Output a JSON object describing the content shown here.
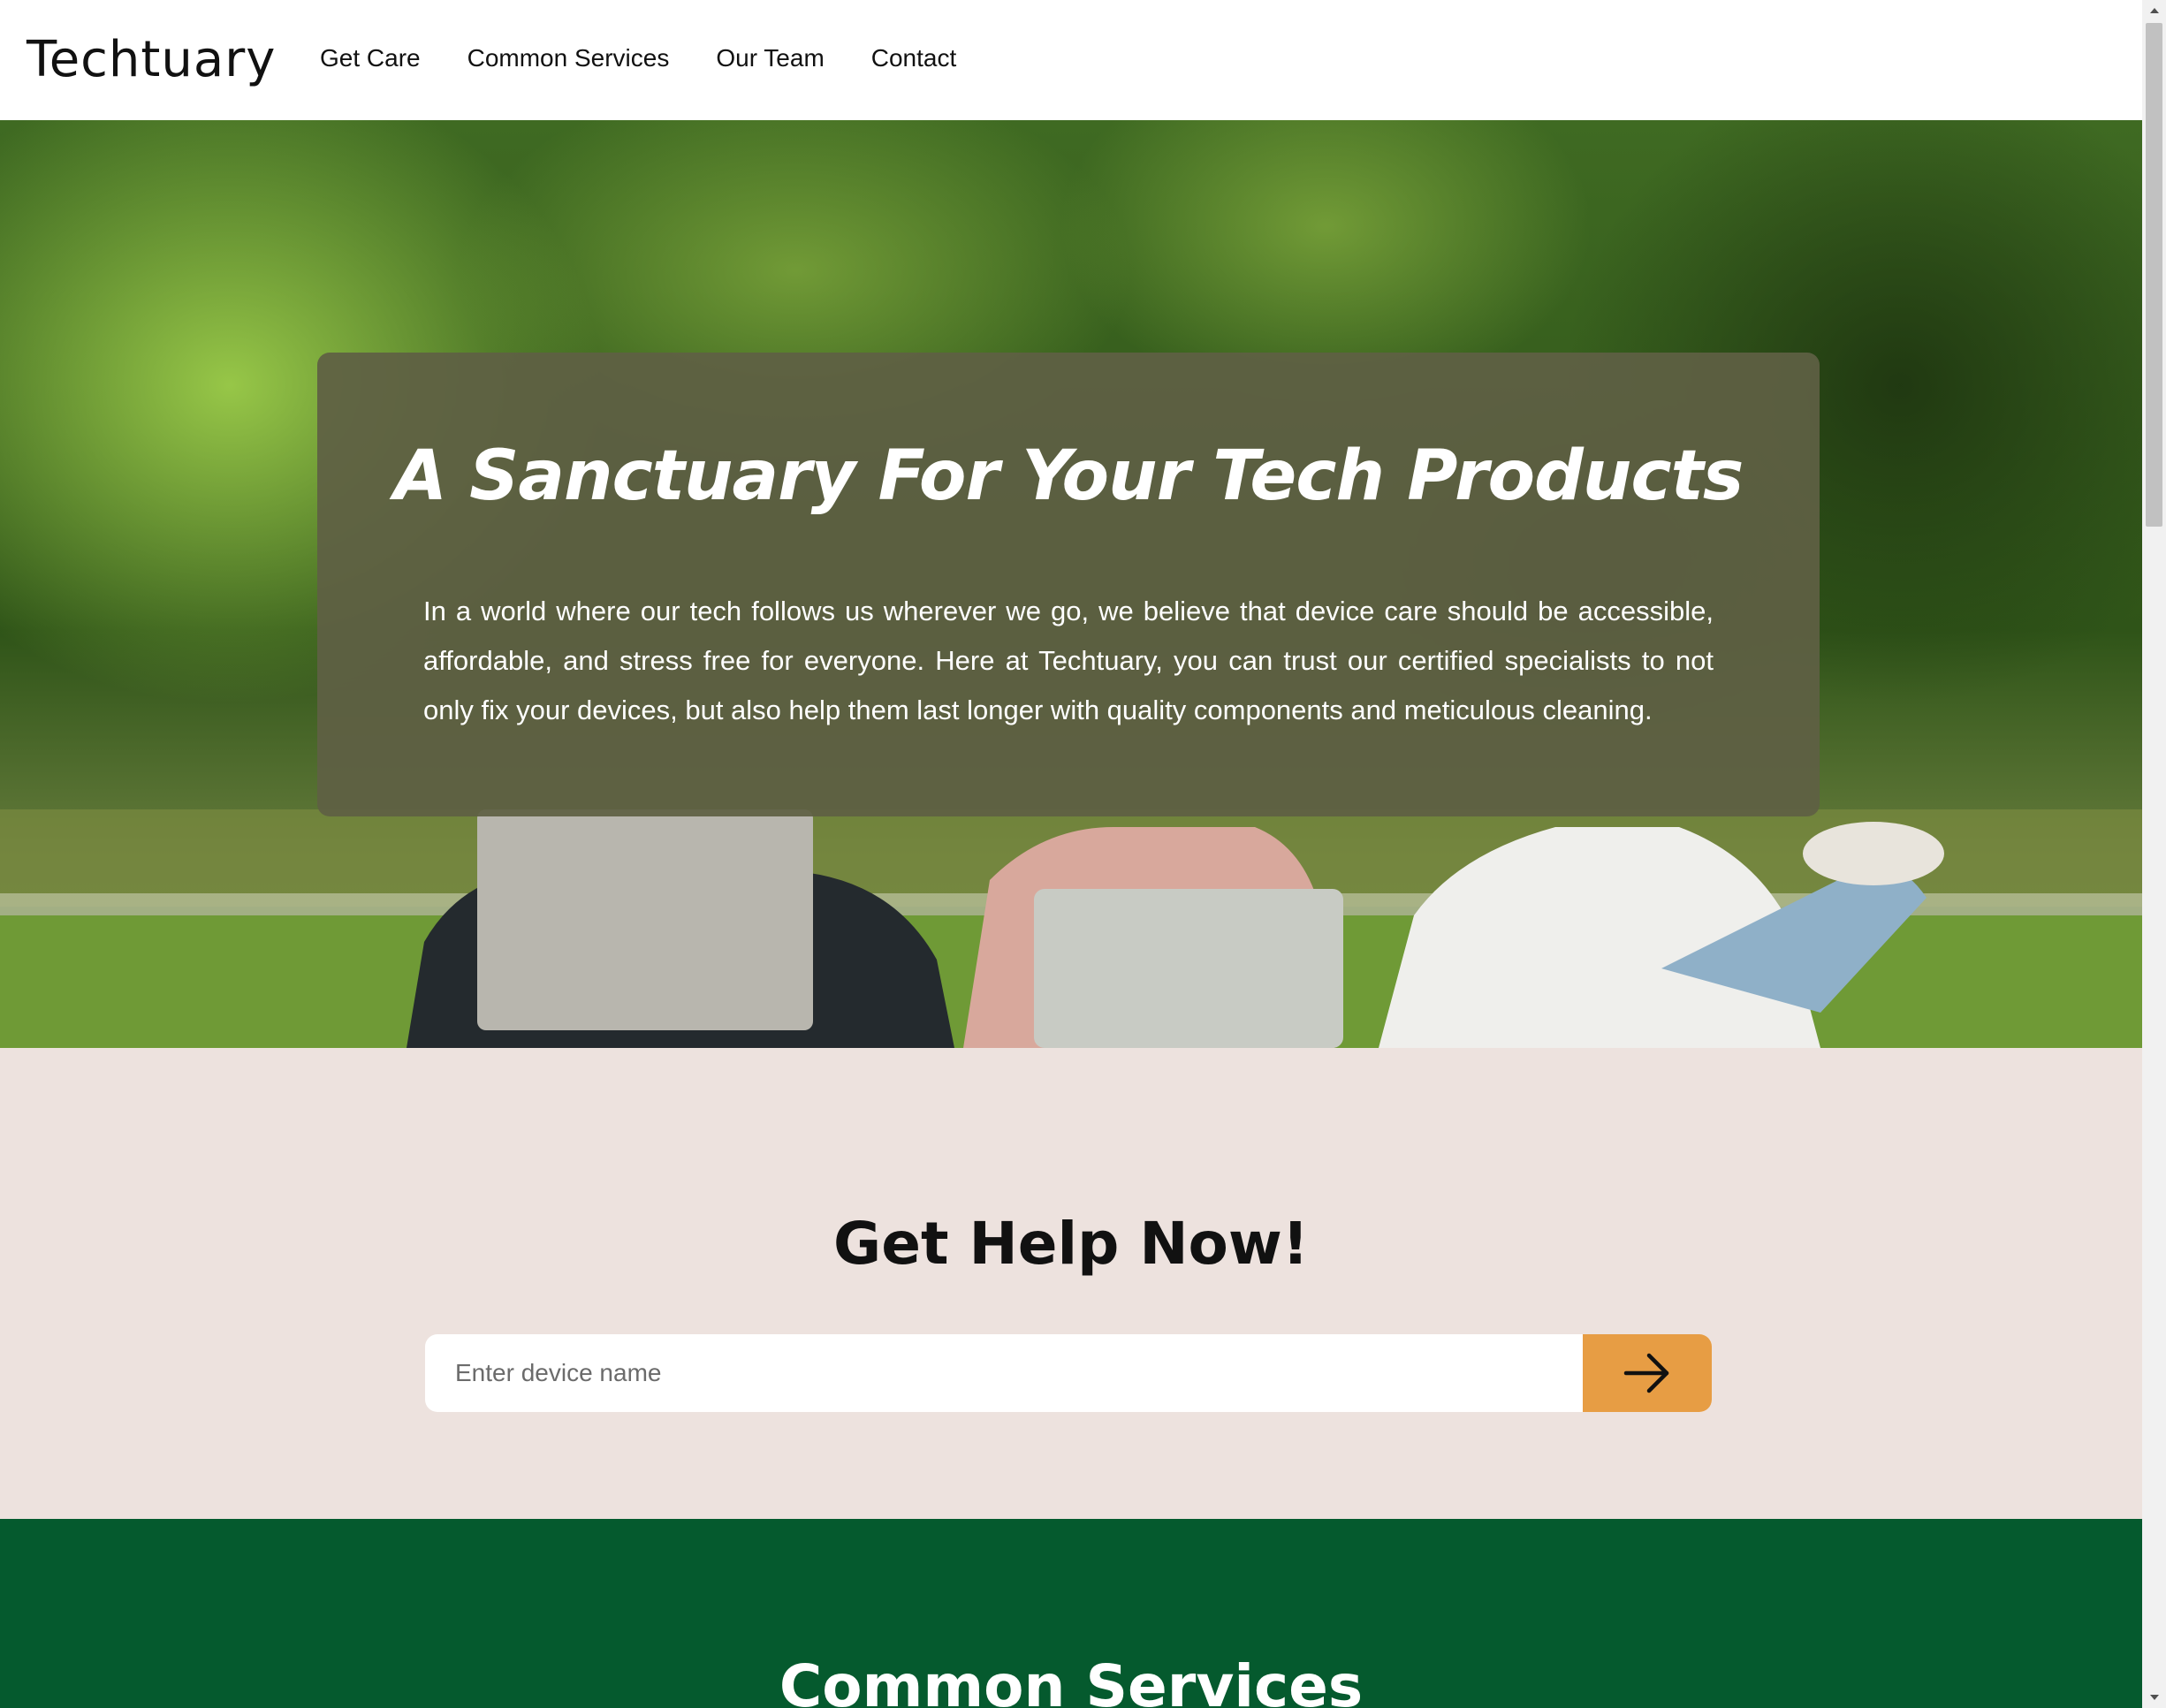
{
  "nav": {
    "logo": "Techtuary",
    "links": [
      "Get Care",
      "Common Services",
      "Our Team",
      "Contact"
    ]
  },
  "hero": {
    "title": "A Sanctuary For Your Tech Products",
    "text": "In a world where our tech follows us wherever we go, we believe that device care should be accessible, affordable, and stress free for everyone. Here at Techtuary, you can trust our certified specialists to not only fix your devices, but also help them last longer with quality components and meticulous cleaning."
  },
  "help": {
    "title": "Get Help Now!",
    "placeholder": "Enter device name",
    "button_icon": "arrow-right-icon"
  },
  "services": {
    "title": "Common Services"
  },
  "colors": {
    "accent": "#e79d44",
    "help_bg": "#ede2de",
    "services_bg": "#055a2e",
    "hero_card": "#5f6044"
  }
}
